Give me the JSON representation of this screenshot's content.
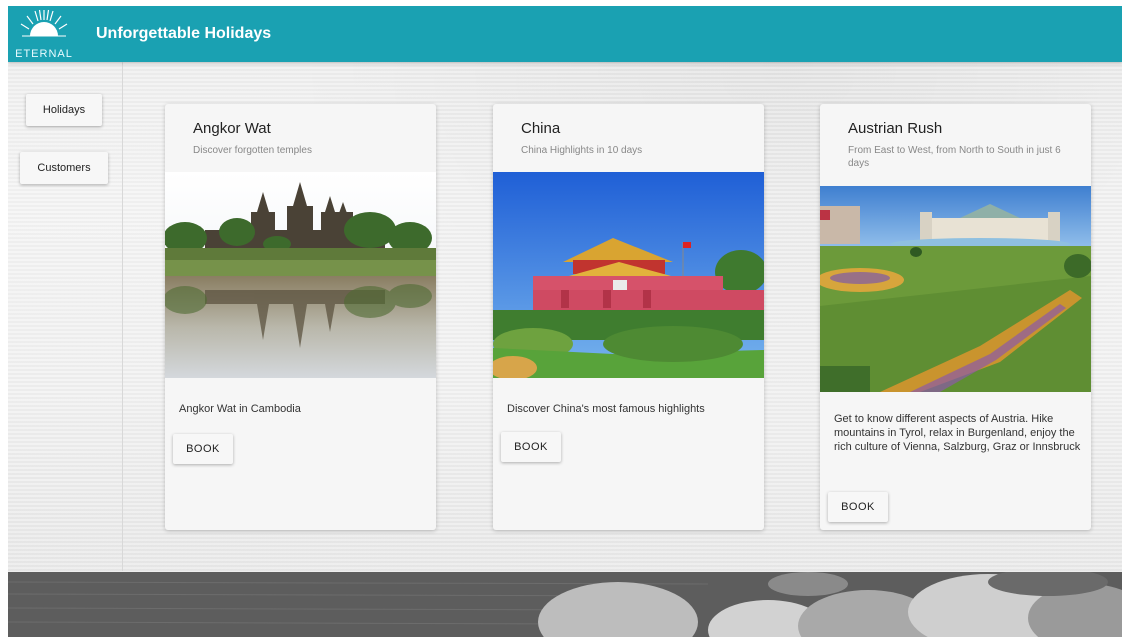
{
  "app": {
    "logo_text": "ETERNAL",
    "title": "Unforgettable Holidays"
  },
  "nav": {
    "holidays": "Holidays",
    "customers": "Customers"
  },
  "cards": [
    {
      "title": "Angkor Wat",
      "subtitle": "Discover forgotten temples",
      "description": "Angkor Wat in Cambodia",
      "button": "BOOK"
    },
    {
      "title": "China",
      "subtitle": "China Highlights in 10 days",
      "description": "Discover China's most famous highlights",
      "button": "BOOK"
    },
    {
      "title": "Austrian Rush",
      "subtitle": "From East to West, from North to South in just 6 days",
      "description": "Get to know different aspects of Austria. Hike mountains in Tyrol, relax in Burgenland, enjoy the rich culture of Vienna, Salzburg, Graz or Innsbruck",
      "button": "BOOK"
    }
  ],
  "colors": {
    "header": "#1aa1b2",
    "card": "#f6f6f6"
  }
}
